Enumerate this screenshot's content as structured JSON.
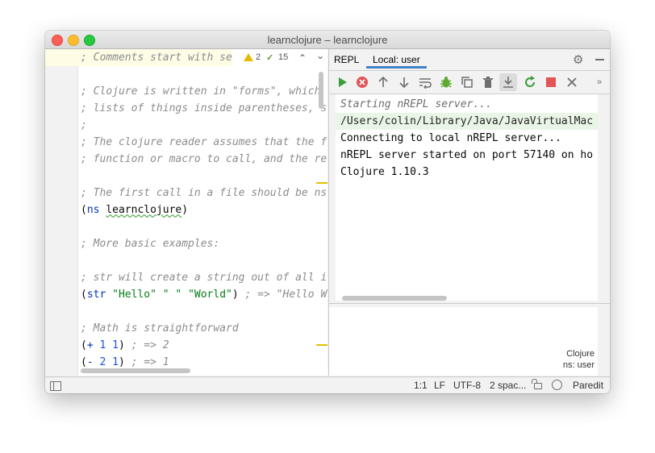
{
  "window": {
    "title": "learnclojure – learnclojure"
  },
  "editor": {
    "lines": [
      "; Comments start with se",
      "",
      "; Clojure is written in \"forms\", which",
      "; lists of things inside parentheses, s",
      ";",
      "; The clojure reader assumes that the f",
      "; function or macro to call, and the re",
      "",
      "; The first call in a file should be ns",
      "",
      "",
      "; More basic examples:",
      "",
      "; str will create a string out of all i",
      "",
      "",
      "; Math is straightforward",
      "",
      ""
    ],
    "ns_line": {
      "open": "(",
      "kw": "ns",
      "name": "learnclojure",
      "close": ")"
    },
    "str_line": {
      "open": "(",
      "kw": "str",
      "a": "\"Hello\"",
      "b": "\" \"",
      "c": "\"World\"",
      "close": ")",
      "comment": " ; => \"Hello W"
    },
    "plus_line": {
      "open": "(",
      "op": "+",
      "a": "1",
      "b": "1",
      "close": ")",
      "comment": " ; => 2"
    },
    "minus_line": {
      "open": "(",
      "op": "-",
      "a": "2",
      "b": "1",
      "close": ")",
      "comment": " ; => 1"
    },
    "inspection": {
      "warnings": "2",
      "weak_warnings": "15"
    }
  },
  "repl": {
    "tab_repl": "REPL",
    "tab_local": "Local: user",
    "console": {
      "line1": "Starting nREPL server...",
      "line2": "/Users/colin/Library/Java/JavaVirtualMac",
      "line3": "Connecting to local nREPL server...",
      "line4": "nREPL server started on port 57140 on ho",
      "line5": "Clojure 1.10.3"
    },
    "info": {
      "language": "Clojure",
      "namespace": "ns: user"
    },
    "colors": {
      "run": "#3a9d3a",
      "stop": "#e05555",
      "debug": "#5fa833",
      "accent": "#4083c9"
    }
  },
  "statusbar": {
    "position": "1:1",
    "line_sep": "LF",
    "encoding": "UTF-8",
    "indent": "2 spac...",
    "mode": "Paredit"
  }
}
